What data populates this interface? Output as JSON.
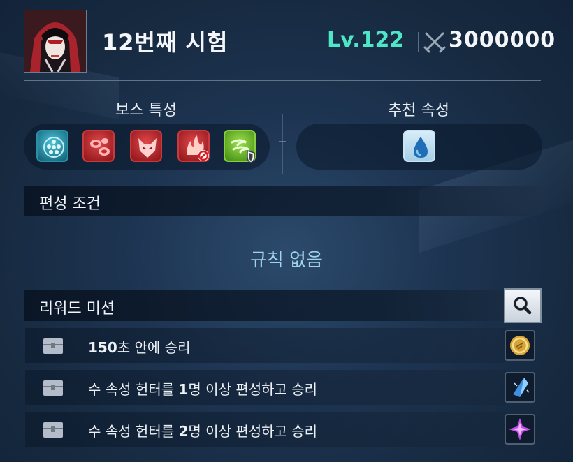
{
  "header": {
    "title": "12번째 시험",
    "level": "Lv.122",
    "power": "3000000",
    "avatar_icon": "hooded-character-portrait",
    "power_icon": "crossed-swords-icon"
  },
  "boss_traits": {
    "title": "보스 특성",
    "icons": [
      "teal-orb-icon",
      "red-blood-cells-icon",
      "red-demon-mask-icon",
      "red-flame-no-icon",
      "green-wind-shield-icon"
    ]
  },
  "recommended": {
    "title": "추천 속성",
    "icons": [
      "water-drop-icon"
    ]
  },
  "formation": {
    "title": "편성 조건",
    "rule_text": "규칙 없음"
  },
  "reward_missions": {
    "title": "리워드 미션",
    "search_icon": "magnifier-icon",
    "items": [
      {
        "text_bold": "150",
        "text_rest": "초 안에 승리",
        "prefix": "",
        "reward_icon": "gold-coin-icon"
      },
      {
        "prefix": "수 속성 헌터를 ",
        "text_bold": "1",
        "text_rest": "명 이상 편성하고 승리",
        "reward_icon": "blue-crystal-icon"
      },
      {
        "prefix": "수 속성 헌터를 ",
        "text_bold": "2",
        "text_rest": "명 이상 편성하고 승리",
        "reward_icon": "purple-star-gem-icon"
      }
    ]
  },
  "colors": {
    "level": "#4fe6c8",
    "rule_text": "#9fd4ea",
    "background": "#1d3451"
  }
}
